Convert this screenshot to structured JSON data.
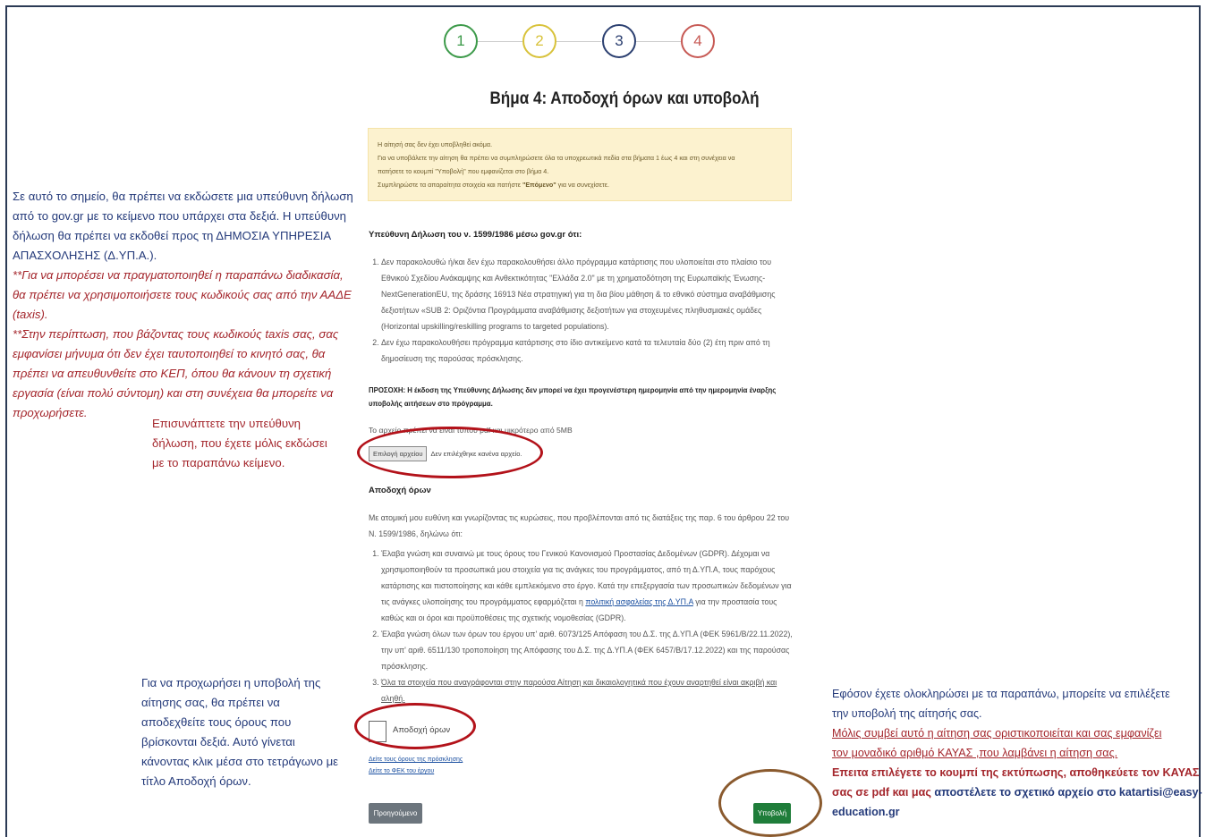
{
  "steps": [
    "1",
    "2",
    "3",
    "4"
  ],
  "step_colors": [
    "#3d9a4a",
    "#d8c23a",
    "#2b3f70",
    "#c75a55"
  ],
  "title": "Βήμα 4: Αποδοχή όρων και υποβολή",
  "alert": {
    "line1": "Η αίτησή σας δεν έχει υποβληθεί ακόμα.",
    "line2": "Για να υποβάλετε την αίτηση θα πρέπει να συμπληρώσετε όλα τα υποχρεωτικά πεδία στα βήματα 1 έως 4 και στη συνέχεια να",
    "line3": "πατήσετε το κουμπί \"Υποβολή\" που εμφανίζεται στο βήμα 4.",
    "line4_pre": "Συμπληρώστε τα απαραίτητα στοιχεία και πατήστε ",
    "line4_bold": "\"Επόμενο\"",
    "line4_post": " για να συνεχίσετε."
  },
  "declaration": {
    "heading": "Υπεύθυνη Δήλωση του ν. 1599/1986 μέσω gov.gr ότι:",
    "item1": "Δεν παρακολουθώ ή/και δεν έχω παρακολουθήσει άλλο πρόγραμμα κατάρτισης που υλοποιείται στο πλαίσιο του Εθνικού Σχεδίου Ανάκαμψης και Ανθεκτικότητας \"Ελλάδα 2.0\" με τη χρηματοδότηση της Ευρωπαϊκής Ένωσης-NextGenerationEU, της δράσης 16913 Νέα στρατηγική για τη δια βίου μάθηση & το εθνικό σύστημα αναβάθμισης δεξιοτήτων «SUB 2: Οριζόντια Προγράμματα αναβάθμισης δεξιοτήτων για στοχευμένες πληθυσμιακές ομάδες (Horizontal upskilling/reskilling programs to targeted populations).",
    "item2": "Δεν έχω παρακολουθήσει πρόγραμμα κατάρτισης στο ίδιο αντικείμενο κατά τα τελευταία δύο (2) έτη πριν από τη δημοσίευση της παρούσας πρόσκλησης."
  },
  "warning": "ΠΡΟΣΟΧΗ: Η έκδοση της Υπεύθυνης Δήλωσης δεν μπορεί να έχει προγενέστερη ημερομηνία από την ημερομηνία έναρξης υποβολής αιτήσεων στο πρόγραμμα.",
  "file": {
    "hint": "Το αρχείο πρέπει να είναι τύπου pdf και μικρότερο από 5MB",
    "button": "Επιλογή αρχείου",
    "status": "Δεν επιλέχθηκε κανένα αρχείο."
  },
  "terms": {
    "heading": "Αποδοχή όρων",
    "intro": "Με ατομική μου ευθύνη και γνωρίζοντας τις κυρώσεις, που προβλέπονται από τις διατάξεις της παρ. 6 του άρθρου 22 του Ν. 1599/1986, δηλώνω ότι:",
    "item1_pre": "Έλαβα γνώση και συναινώ με τους όρους του Γενικού Κανονισμού Προστασίας Δεδομένων (GDPR). Δέχομαι να χρησιμοποιηθούν τα προσωπικά μου στοιχεία για τις ανάγκες του προγράμματος, από τη Δ.ΥΠ.Α, τους παρόχους κατάρτισης και πιστοποίησης και κάθε εμπλεκόμενο στο έργο. Κατά την επεξεργασία των προσωπικών δεδομένων για τις ανάγκες υλοποίησης του προγράμματος εφαρμόζεται η ",
    "item1_link": "πολιτική ασφαλείας της Δ.ΥΠ.Α",
    "item1_post": " για την προστασία τους καθώς και οι όροι και προϋποθέσεις της σχετικής νομοθεσίας (GDPR).",
    "item2": "Έλαβα γνώση όλων των όρων του έργου υπ' αριθ. 6073/125 Απόφαση του Δ.Σ. της Δ.ΥΠ.Α (ΦΕΚ 5961/Β/22.11.2022), την υπ' αριθ. 6511/130 τροποποίηση της Απόφασης του Δ.Σ. της Δ.ΥΠ.Α (ΦΕΚ 6457/Β/17.12.2022) και της παρούσας πρόσκλησης.",
    "item3": "Όλα τα στοιχεία που αναγράφονται στην παρούσα Αίτηση και δικαιολογητικά που έχουν αναρτηθεί είναι ακριβή και αληθή.",
    "checkbox_label": "Αποδοχή όρων",
    "link1": "Δείτε τους όρους της πρόσκλησης",
    "link2": "Δείτε το ΦΕΚ του έργου"
  },
  "buttons": {
    "prev": "Προηγούμενο",
    "submit": "Υποβολή"
  },
  "annotations": {
    "top_left": {
      "navy1": "Σε αυτό το σημείο, θα πρέπει να εκδώσετε μια υπεύθυνη δήλωση",
      "navy2": "από το gov.gr με το κείμενο που υπάρχει στα δεξιά. Η υπεύθυνη",
      "navy3": "δήλωση θα πρέπει να εκδοθεί προς τη ΔΗΜΟΣΙΑ ΥΠΗΡΕΣΙΑ",
      "navy4": "ΑΠΑΣΧΟΛΗΣΗΣ (Δ.ΥΠ.Α.).",
      "red1": "**Για να μπορέσει να πραγματοποιηθεί η παραπάνω διαδικασία,",
      "red2": "θα πρέπει να χρησιμοποιήσετε τους κωδικούς σας από την ΑΑΔΕ",
      "red3": "(taxis).",
      "red4": "**Στην περίπτωση, που βάζοντας τους κωδικούς taxis σας, σας",
      "red5": "εμφανίσει μήνυμα ότι δεν έχει ταυτοποιηθεί το κινητό σας, θα",
      "red6": "πρέπει να απευθυνθείτε στο ΚΕΠ, όπου θα κάνουν τη σχετική",
      "red7": "εργασία (είναι πολύ σύντομη) και στη συνέχεια θα μπορείτε να",
      "red8": "προχωρήσετε."
    },
    "attach": {
      "line1": "Επισυνάπτετε την υπεύθυνη",
      "line2": "δήλωση, που έχετε μόλις εκδώσει",
      "line3": "με το παραπάνω κείμενο."
    },
    "accept": {
      "line1": "Για να προχωρήσει η υποβολή της",
      "line2": "αίτησης σας, θα πρέπει να",
      "line3": "αποδεχθείτε τους όρους που",
      "line4": "βρίσκονται δεξιά. Αυτό γίνεται",
      "line5": "κάνοντας κλικ μέσα στο τετράγωνο με",
      "line6": "τίτλο Αποδοχή όρων."
    },
    "submit": {
      "line1": "Εφόσον έχετε ολοκληρώσει με τα παραπάνω, μπορείτε να επιλέξετε",
      "line2": "την υποβολή της αίτησής σας.",
      "line3": "Μόλις συμβεί αυτό η αίτηση σας οριστικοποιείται και σας εμφανίζει",
      "line4": "τον μοναδικό αριθμό ΚΑΥΑΣ ,που λαμβάνει η αίτηση σας.",
      "line5": "Επειτα επιλέγετε το κουμπί της εκτύπωσης, αποθηκεύετε τον ΚΑΥΑΣ",
      "line6a": "σας σε pdf και μας ",
      "line6b": "αποστέλετε το σχετικό αρχείο στο katartisi@easy-",
      "line7": "education.gr"
    }
  }
}
